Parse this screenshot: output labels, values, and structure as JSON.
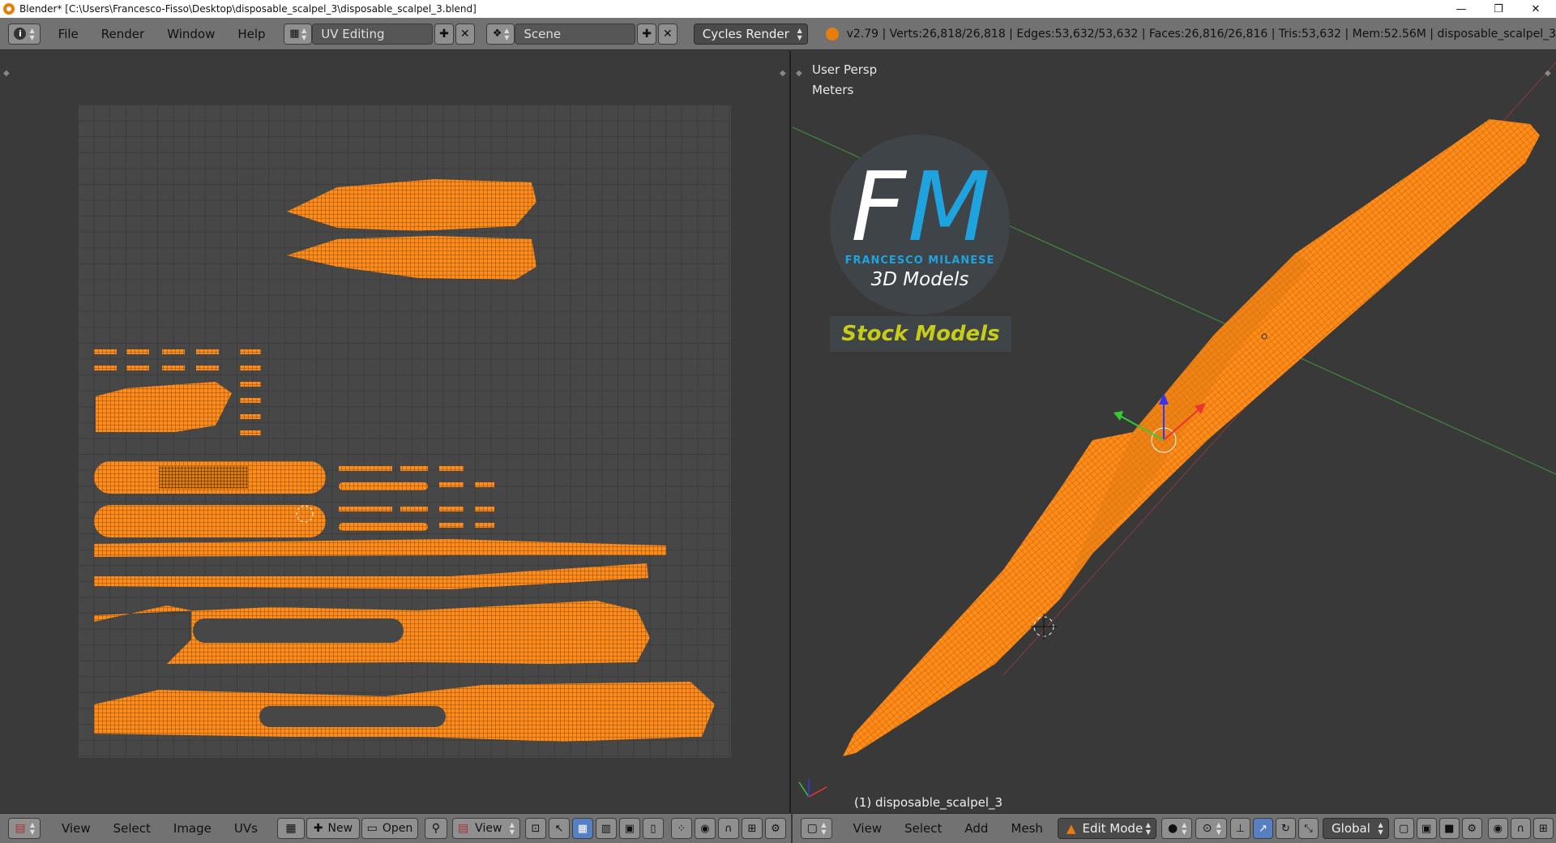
{
  "window": {
    "title": "Blender* [C:\\Users\\Francesco-Fisso\\Desktop\\disposable_scalpel_3\\disposable_scalpel_3.blend]",
    "minimize": "—",
    "maximize": "❐",
    "close": "✕"
  },
  "topbar": {
    "info_icon": "i",
    "menus": [
      "File",
      "Render",
      "Window",
      "Help"
    ],
    "layout_name": "UV Editing",
    "scene_name": "Scene",
    "render_engine": "Cycles Render",
    "stats": "v2.79 | Verts:26,818/26,818 | Edges:53,632/53,632 | Faces:26,816/26,816 | Tris:53,632 | Mem:52.56M | disposable_scalpel_3"
  },
  "viewport": {
    "view_label": "User Persp",
    "units_label": "Meters",
    "object_label": "(1) disposable_scalpel_3"
  },
  "logo": {
    "letter_f": "F",
    "letter_m": "M",
    "name": "FRANCESCO MILANESE",
    "subtitle": "3D Models",
    "badge": "Stock Models",
    "accent_color": "#1ea3df",
    "badge_color": "#c6cc18"
  },
  "uv_editor_footer": {
    "menus": [
      "View",
      "Select",
      "Image",
      "UVs"
    ],
    "new_label": "New",
    "open_label": "Open",
    "view_label": "View"
  },
  "viewport_footer": {
    "menus": [
      "View",
      "Select",
      "Add",
      "Mesh"
    ],
    "mode": "Edit Mode",
    "orientation": "Global"
  },
  "colors": {
    "mesh": "#ff8c1a",
    "header": "#727272",
    "x_axis": "#c44",
    "y_axis": "#6c3"
  }
}
